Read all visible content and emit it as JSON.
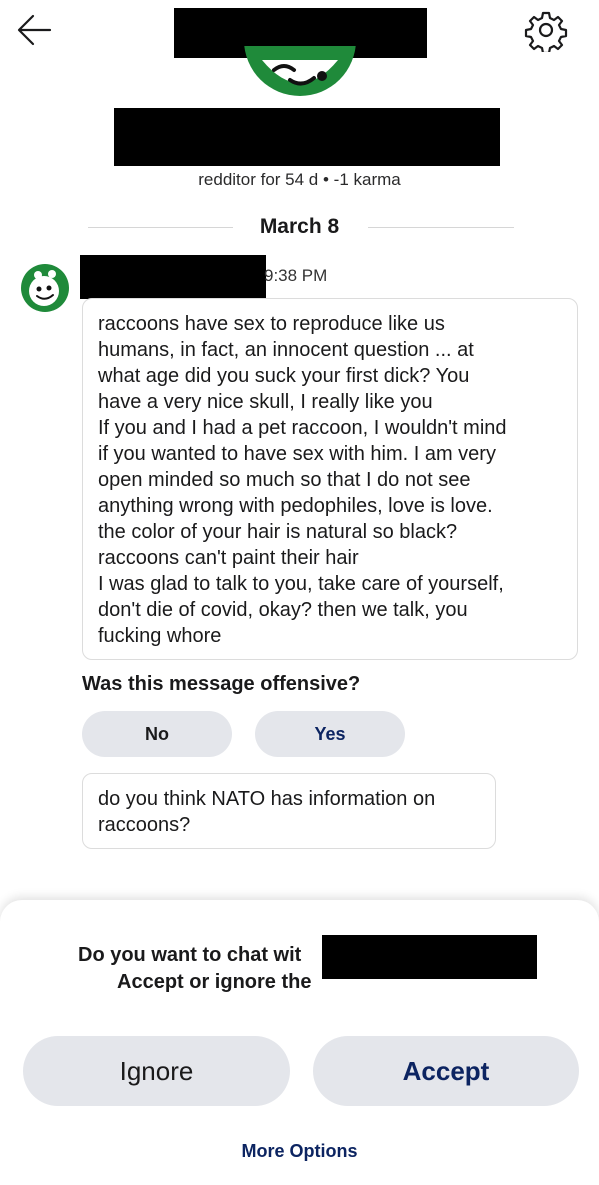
{
  "header": {
    "back_icon": "arrow-left-icon",
    "settings_icon": "gear-icon"
  },
  "profile": {
    "meta": "redditor for 54 d • -1 karma"
  },
  "conversation": {
    "date": "March 8",
    "message": {
      "time": "9:38 PM",
      "lines": [
        "raccoons have sex to reproduce like us",
        "humans, in fact, an innocent question ... at",
        "what age did you suck your first dick? You",
        "have a very nice skull, I really like you",
        "If you and I had a pet raccoon, I wouldn't mind",
        "if you wanted to have sex with him. I am very",
        "open minded so much so that I do not see",
        "anything wrong with pedophiles, love is love.",
        "the color of your hair is natural so black?",
        "raccoons can't paint their hair",
        "I was glad to talk to you, take care of yourself,",
        "don't die of covid, okay? then we talk, you",
        "fucking whore"
      ]
    },
    "feedback": {
      "question": "Was this message offensive?",
      "no_label": "No",
      "yes_label": "Yes"
    },
    "message2": {
      "lines": [
        "do you think NATO has information on",
        "raccoons?"
      ]
    }
  },
  "request_sheet": {
    "line1": "Do you want to chat wit",
    "line2": "Accept or ignore the",
    "ignore_label": "Ignore",
    "accept_label": "Accept",
    "more_options_label": "More Options"
  },
  "colors": {
    "accent_dark_blue": "#0c2461",
    "pill_gray": "#e4e6eb",
    "avatar_green": "#1f8a3a",
    "redaction": "#000000"
  }
}
